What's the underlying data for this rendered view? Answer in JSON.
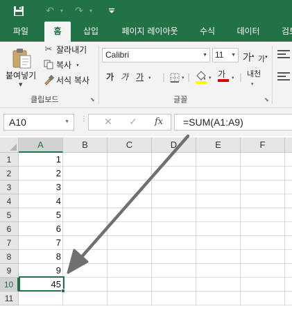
{
  "qat": {
    "save_icon": "save-icon",
    "undo_icon": "undo-icon",
    "redo_icon": "redo-icon",
    "customize_icon": "customize-qat-icon"
  },
  "tabs": [
    "파일",
    "홈",
    "삽입",
    "페이지 레이아웃",
    "수식",
    "데이터",
    "검토"
  ],
  "active_tab": "홈",
  "ribbon": {
    "clipboard": {
      "paste_label": "붙여넣기",
      "cut_label": "잘라내기",
      "copy_label": "복사",
      "format_painter_label": "서식 복사",
      "group_label": "클립보드"
    },
    "font": {
      "font_name": "Calibri",
      "font_size": "11",
      "grow_label": "가",
      "shrink_label": "가",
      "bold_label": "가",
      "italic_label": "가",
      "underline_label": "가",
      "font_color_label": "가",
      "phonetic_label": "내천",
      "group_label": "글꼴"
    }
  },
  "formula_bar": {
    "name_box": "A10",
    "cancel_symbol": "✕",
    "enter_symbol": "✓",
    "fx_label": "fx",
    "formula": "=SUM(A1:A9)"
  },
  "grid": {
    "columns": [
      "A",
      "B",
      "C",
      "D",
      "E",
      "F"
    ],
    "rows": [
      "1",
      "2",
      "3",
      "4",
      "5",
      "6",
      "7",
      "8",
      "9",
      "10",
      "11"
    ],
    "values_a": [
      "1",
      "2",
      "3",
      "4",
      "5",
      "6",
      "7",
      "8",
      "9",
      "45",
      ""
    ],
    "selected_cell": "A10"
  },
  "annotation": {
    "arrow_color": "#707070"
  },
  "colors": {
    "brand": "#217346",
    "ribbon_bg": "#f3f3f3"
  }
}
